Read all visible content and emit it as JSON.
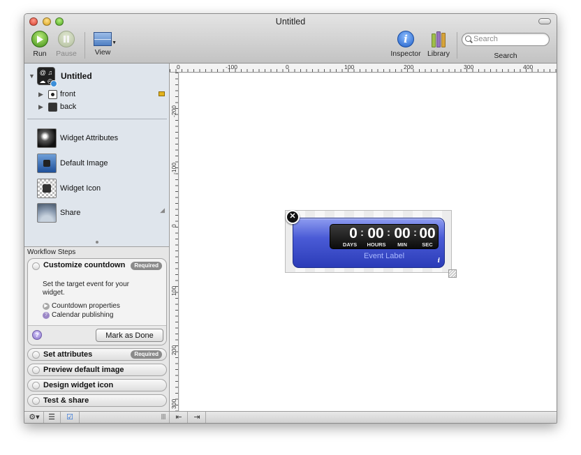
{
  "window": {
    "title": "Untitled"
  },
  "toolbar": {
    "run_label": "Run",
    "pause_label": "Pause",
    "view_label": "View",
    "inspector_label": "Inspector",
    "library_label": "Library",
    "search_label": "Search",
    "search_placeholder": "Search",
    "inspector_glyph": "i"
  },
  "sidebar": {
    "project": {
      "title": "Untitled",
      "icon_glyph": "@ ♫\n☁ ◴"
    },
    "layers": [
      {
        "label": "front"
      },
      {
        "label": "back"
      }
    ],
    "items": [
      {
        "label": "Widget Attributes",
        "icon": "widget-attributes-icon"
      },
      {
        "label": "Default Image",
        "icon": "default-image-icon"
      },
      {
        "label": "Widget Icon",
        "icon": "widget-icon-icon"
      },
      {
        "label": "Share",
        "icon": "share-icon"
      }
    ]
  },
  "workflow": {
    "header": "Workflow Steps",
    "active_step": {
      "title": "Customize countdown",
      "badge": "Required",
      "description": "Set the target event for your widget.",
      "links": [
        "Countdown properties",
        "Calendar publishing"
      ],
      "help_glyph": "?",
      "done_button": "Mark as Done"
    },
    "steps": [
      {
        "title": "Set attributes",
        "badge": "Required"
      },
      {
        "title": "Preview default image",
        "badge": ""
      },
      {
        "title": "Design widget icon",
        "badge": ""
      },
      {
        "title": "Test & share",
        "badge": ""
      }
    ]
  },
  "ruler": {
    "top": [
      "-100",
      "0",
      "100",
      "200",
      "300",
      "400"
    ],
    "left": [
      "-200",
      "-100",
      "0",
      "100",
      "200",
      "300"
    ]
  },
  "widget": {
    "values": {
      "days": "0",
      "hours": "00",
      "min": "00",
      "sec": "00"
    },
    "labels": {
      "days": "DAYS",
      "hours": "HOURS",
      "min": "MIN",
      "sec": "SEC"
    },
    "separator": ":",
    "event_label": "Event Label",
    "info_glyph": "i",
    "close_glyph": "✕"
  },
  "colors": {
    "widget_blue": "#3a4bc8",
    "event_label": "#a9b8ff",
    "sidebar_bg": "#dfe5ec"
  }
}
